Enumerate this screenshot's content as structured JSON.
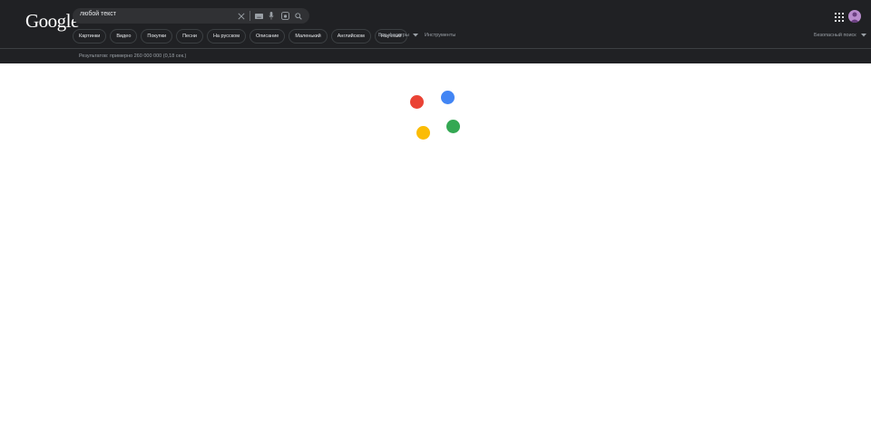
{
  "header": {
    "logo_text": "Google",
    "search": {
      "value": "любой текст"
    },
    "icons": [
      "clear-icon",
      "keyboard-icon",
      "mic-icon",
      "lens-icon",
      "search-icon",
      "apps-icon"
    ]
  },
  "chips": [
    {
      "label": "Картинки"
    },
    {
      "label": "Видео"
    },
    {
      "label": "Покупки"
    },
    {
      "label": "Песни"
    },
    {
      "label": "На русском"
    },
    {
      "label": "Описание"
    },
    {
      "label": "Маленький"
    },
    {
      "label": "Английском"
    },
    {
      "label": "Научный"
    }
  ],
  "toolbar": {
    "all_filters_label": "Все фильтры",
    "tools_label": "Инструменты",
    "safe_search_label": "Безопасный поиск"
  },
  "results": {
    "stats": "Результатов: примерно 260 000 000 (0,18 сек.)"
  },
  "loader": {
    "colors": {
      "red": "#ea4335",
      "blue": "#4285f4",
      "green": "#34a853",
      "yellow": "#fbbc05"
    }
  },
  "colors": {
    "header_bg": "#202124",
    "searchbox_bg": "#303134",
    "text_primary": "#e8eaed",
    "text_secondary": "#9aa0a6"
  }
}
